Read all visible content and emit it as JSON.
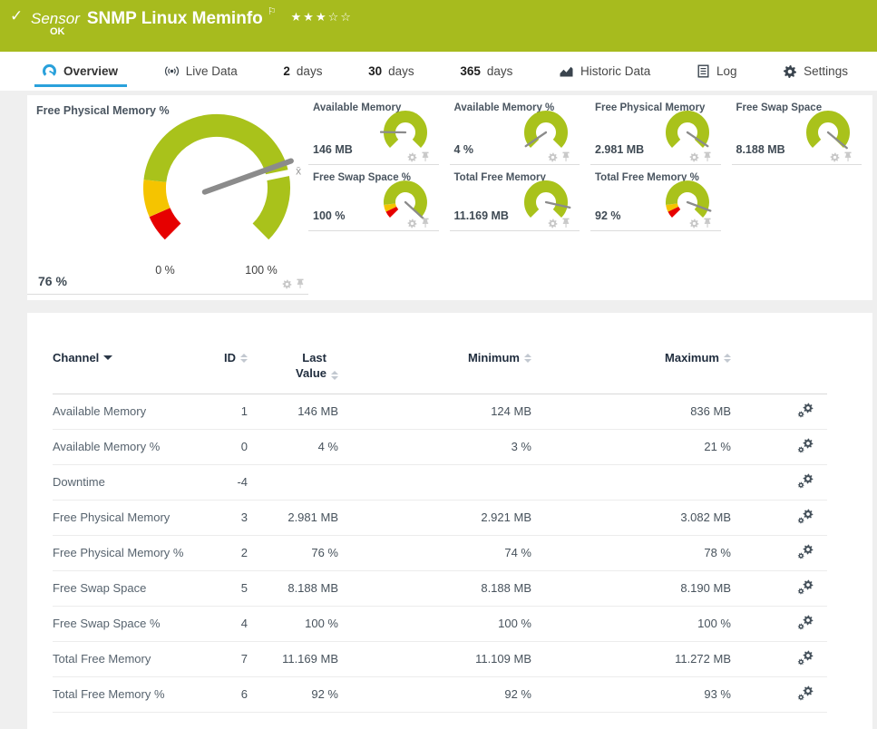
{
  "colors": {
    "brand_green": "#A7BB1E",
    "gauge_green": "#A9C21B",
    "gauge_yellow": "#F5C400",
    "gauge_red": "#E60000",
    "accent_blue": "#2AA1DB",
    "needle_grey": "#8B8B8B"
  },
  "header": {
    "check_icon": "✓",
    "kind": "Sensor",
    "title": "SNMP Linux Meminfo",
    "flag_icon": "⚐",
    "stars_filled": "★★★",
    "stars_empty": "☆☆",
    "rating": {
      "filled": 3,
      "total": 5
    },
    "status": "OK"
  },
  "tabs": [
    {
      "id": "overview",
      "icon": "gauge-icon",
      "label": "Overview",
      "active": true
    },
    {
      "id": "live-data",
      "icon": "broadcast-icon",
      "label": "Live Data"
    },
    {
      "id": "2-days",
      "num": "2",
      "label": "days"
    },
    {
      "id": "30-days",
      "num": "30",
      "label": "days"
    },
    {
      "id": "365-days",
      "num": "365",
      "label": "days"
    },
    {
      "id": "historic-data",
      "icon": "chart-icon",
      "label": "Historic Data"
    },
    {
      "id": "log",
      "icon": "log-icon",
      "label": "Log"
    },
    {
      "id": "settings",
      "icon": "gear-icon",
      "label": "Settings"
    }
  ],
  "gauges": {
    "main": {
      "title": "Free Physical Memory %",
      "value": "76 %",
      "value_pct": 76,
      "min_label": "0 %",
      "max_label": "100 %",
      "avg_label": "x̄",
      "avg_pct": 79,
      "segments": [
        {
          "to_pct": 8,
          "color": "#E60000"
        },
        {
          "to_pct": 19,
          "color": "#F5C400"
        },
        {
          "to_pct": 100,
          "color": "#A9C21B"
        }
      ]
    },
    "minis": [
      {
        "title": "Available Memory",
        "value": "146 MB",
        "value_pct": 17,
        "segments": [
          {
            "to_pct": 100,
            "color": "#A9C21B"
          }
        ]
      },
      {
        "title": "Available Memory %",
        "value": "4 %",
        "value_pct": 4,
        "segments": [
          {
            "to_pct": 100,
            "color": "#A9C21B"
          }
        ]
      },
      {
        "title": "Free Physical Memory",
        "value": "2.981 MB",
        "value_pct": 96,
        "segments": [
          {
            "to_pct": 100,
            "color": "#A9C21B"
          }
        ]
      },
      {
        "title": "Free Swap Space",
        "value": "8.188 MB",
        "value_pct": 98,
        "segments": [
          {
            "to_pct": 100,
            "color": "#A9C21B"
          }
        ]
      },
      {
        "title": "Free Swap Space %",
        "value": "100 %",
        "value_pct": 99,
        "segments": [
          {
            "to_pct": 7,
            "color": "#E60000"
          },
          {
            "to_pct": 14,
            "color": "#F5C400"
          },
          {
            "to_pct": 100,
            "color": "#A9C21B"
          }
        ]
      },
      {
        "title": "Total Free Memory",
        "value": "11.169 MB",
        "value_pct": 88,
        "segments": [
          {
            "to_pct": 100,
            "color": "#A9C21B"
          }
        ]
      },
      {
        "title": "Total Free Memory %",
        "value": "92 %",
        "value_pct": 91,
        "segments": [
          {
            "to_pct": 7,
            "color": "#E60000"
          },
          {
            "to_pct": 14,
            "color": "#F5C400"
          },
          {
            "to_pct": 100,
            "color": "#A9C21B"
          }
        ]
      }
    ]
  },
  "table": {
    "columns": [
      {
        "label": "Channel",
        "align": "left",
        "sort": "active-desc"
      },
      {
        "label": "ID",
        "align": "right",
        "sort": "both"
      },
      {
        "label": "Last Value",
        "align": "right",
        "sort": "both",
        "wrap": true
      },
      {
        "label": "Minimum",
        "align": "right",
        "sort": "both"
      },
      {
        "label": "Maximum",
        "align": "right",
        "sort": "both"
      },
      {
        "label": "",
        "align": "right",
        "sort": "none"
      }
    ],
    "rows": [
      {
        "name": "Available Memory",
        "id": "1",
        "last": "146 MB",
        "min": "124 MB",
        "max": "836 MB"
      },
      {
        "name": "Available Memory %",
        "id": "0",
        "last": "4 %",
        "min": "3 %",
        "max": "21 %"
      },
      {
        "name": "Downtime",
        "id": "-4",
        "last": "",
        "min": "",
        "max": ""
      },
      {
        "name": "Free Physical Memory",
        "id": "3",
        "last": "2.981 MB",
        "min": "2.921 MB",
        "max": "3.082 MB"
      },
      {
        "name": "Free Physical Memory %",
        "id": "2",
        "last": "76 %",
        "min": "74 %",
        "max": "78 %"
      },
      {
        "name": "Free Swap Space",
        "id": "5",
        "last": "8.188 MB",
        "min": "8.188 MB",
        "max": "8.190 MB"
      },
      {
        "name": "Free Swap Space %",
        "id": "4",
        "last": "100 %",
        "min": "100 %",
        "max": "100 %"
      },
      {
        "name": "Total Free Memory",
        "id": "7",
        "last": "11.169 MB",
        "min": "11.109 MB",
        "max": "11.272 MB"
      },
      {
        "name": "Total Free Memory %",
        "id": "6",
        "last": "92 %",
        "min": "92 %",
        "max": "93 %"
      }
    ]
  }
}
